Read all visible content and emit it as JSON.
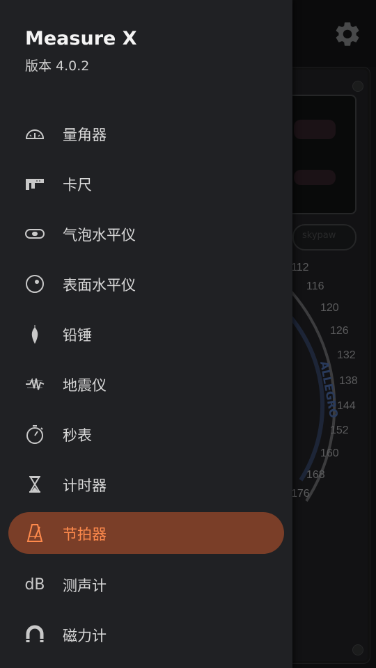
{
  "drawer": {
    "app_name": "Measure X",
    "version": "版本 4.0.2",
    "items": [
      {
        "label": "量角器",
        "icon": "protractor-icon",
        "active": false
      },
      {
        "label": "卡尺",
        "icon": "caliper-icon",
        "active": false
      },
      {
        "label": "气泡水平仪",
        "icon": "bubble-level-icon",
        "active": false
      },
      {
        "label": "表面水平仪",
        "icon": "surface-level-icon",
        "active": false
      },
      {
        "label": "铅锤",
        "icon": "plumb-bob-icon",
        "active": false
      },
      {
        "label": "地震仪",
        "icon": "seismometer-icon",
        "active": false
      },
      {
        "label": "秒表",
        "icon": "stopwatch-icon",
        "active": false
      },
      {
        "label": "计时器",
        "icon": "hourglass-icon",
        "active": false
      },
      {
        "label": "节拍器",
        "icon": "metronome-icon",
        "active": true
      },
      {
        "label": "测声计",
        "icon": "decibel-icon",
        "icon_text": "dB",
        "active": false
      },
      {
        "label": "磁力计",
        "icon": "magnet-icon",
        "active": false
      }
    ]
  },
  "background": {
    "settings_icon": "gear-icon",
    "brand_text": "skypaw",
    "dial_labels": [
      "112",
      "116",
      "120",
      "126",
      "132",
      "138",
      "144",
      "152",
      "160",
      "168",
      "176"
    ],
    "dial_tempo_text": "ALLEGRO"
  },
  "colors": {
    "drawer_bg": "#202124",
    "active_bg": "#7a3e28",
    "active_fg": "#ff8a4c"
  }
}
